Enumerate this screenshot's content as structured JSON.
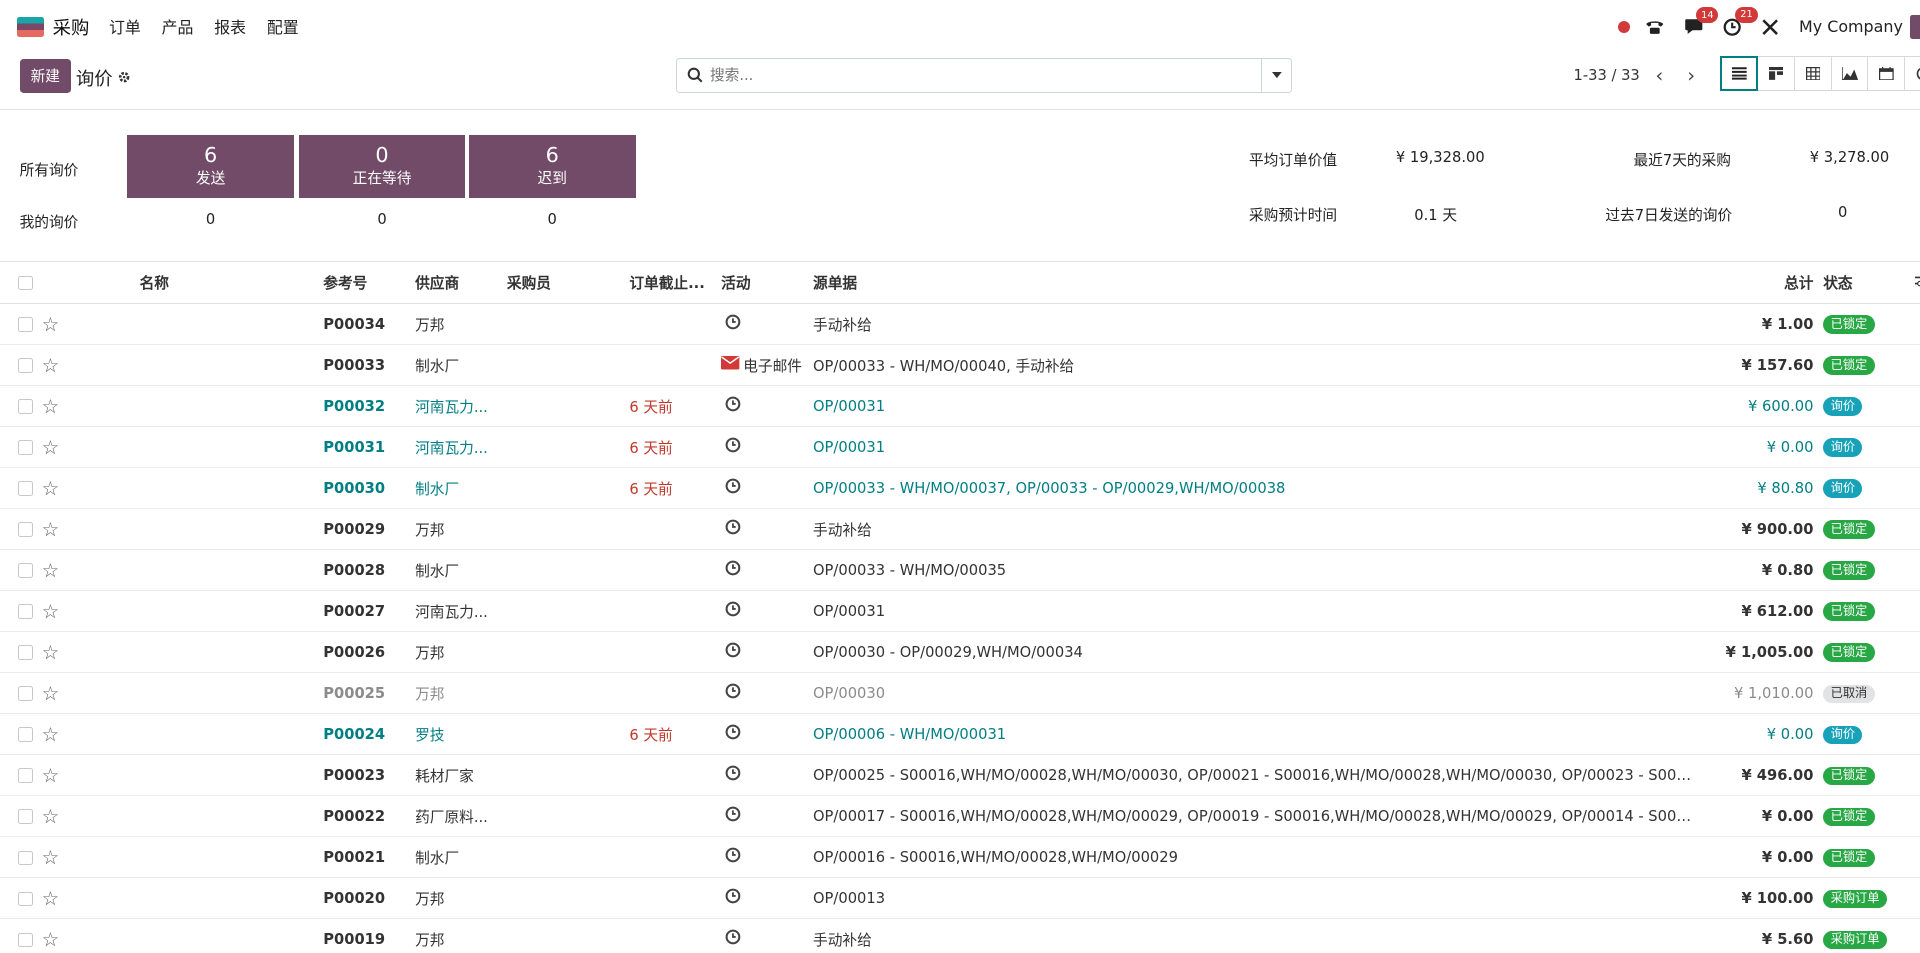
{
  "navbar": {
    "app_name": "采购",
    "menu": [
      "订单",
      "产品",
      "报表",
      "配置"
    ],
    "chat_badge": "14",
    "activity_badge": "21",
    "company": "My Company"
  },
  "cp": {
    "new_label": "新建",
    "breadcrumb": "询价",
    "search_placeholder": "搜索...",
    "pager": "1-33 / 33"
  },
  "dashboard": {
    "all_label": "所有询价",
    "my_label": "我的询价",
    "cards": [
      {
        "value": "6",
        "label": "发送",
        "mine": "0"
      },
      {
        "value": "0",
        "label": "正在等待",
        "mine": "0"
      },
      {
        "value": "6",
        "label": "迟到",
        "mine": "0"
      }
    ],
    "stats": {
      "avg_label": "平均订单价值",
      "avg_value": "¥ 19,328.00",
      "week_label": "最近7天的采购",
      "week_value": "¥ 3,278.00",
      "lead_label": "采购预计时间",
      "lead_value": "0.1 天",
      "sent_label": "过去7日发送的询价",
      "sent_value": "0"
    }
  },
  "table": {
    "headers": {
      "name": "名称",
      "ref": "参考号",
      "vendor": "供应商",
      "buyer": "采购员",
      "deadline": "订单截止...",
      "activity": "活动",
      "source": "源单据",
      "total": "总计",
      "status": "状态"
    },
    "rows": [
      {
        "ref": "P00034",
        "vendor": "万邦",
        "deadline": "",
        "activity": "",
        "source": "手动补给",
        "total": "¥ 1.00",
        "status": "已锁定",
        "style": "normal"
      },
      {
        "ref": "P00033",
        "vendor": "制水厂",
        "deadline": "",
        "activity": "电子邮件",
        "source": "OP/00033 - WH/MO/00040, 手动补给",
        "total": "¥ 157.60",
        "status": "已锁定",
        "style": "normal"
      },
      {
        "ref": "P00032",
        "vendor": "河南瓦力...",
        "deadline": "6 天前",
        "activity": "",
        "source": "OP/00031",
        "total": "¥ 600.00",
        "status": "询价",
        "style": "teal"
      },
      {
        "ref": "P00031",
        "vendor": "河南瓦力...",
        "deadline": "6 天前",
        "activity": "",
        "source": "OP/00031",
        "total": "¥ 0.00",
        "status": "询价",
        "style": "teal"
      },
      {
        "ref": "P00030",
        "vendor": "制水厂",
        "deadline": "6 天前",
        "activity": "",
        "source": "OP/00033 - WH/MO/00037, OP/00033 - OP/00029,WH/MO/00038",
        "total": "¥ 80.80",
        "status": "询价",
        "style": "teal"
      },
      {
        "ref": "P00029",
        "vendor": "万邦",
        "deadline": "",
        "activity": "",
        "source": "手动补给",
        "total": "¥ 900.00",
        "status": "已锁定",
        "style": "normal"
      },
      {
        "ref": "P00028",
        "vendor": "制水厂",
        "deadline": "",
        "activity": "",
        "source": "OP/00033 - WH/MO/00035",
        "total": "¥ 0.80",
        "status": "已锁定",
        "style": "normal"
      },
      {
        "ref": "P00027",
        "vendor": "河南瓦力...",
        "deadline": "",
        "activity": "",
        "source": "OP/00031",
        "total": "¥ 612.00",
        "status": "已锁定",
        "style": "normal"
      },
      {
        "ref": "P00026",
        "vendor": "万邦",
        "deadline": "",
        "activity": "",
        "source": "OP/00030 - OP/00029,WH/MO/00034",
        "total": "¥ 1,005.00",
        "status": "已锁定",
        "style": "normal"
      },
      {
        "ref": "P00025",
        "vendor": "万邦",
        "deadline": "",
        "activity": "",
        "source": "OP/00030",
        "total": "¥ 1,010.00",
        "status": "已取消",
        "style": "muted"
      },
      {
        "ref": "P00024",
        "vendor": "罗技",
        "deadline": "6 天前",
        "activity": "",
        "source": "OP/00006 - WH/MO/00031",
        "total": "¥ 0.00",
        "status": "询价",
        "style": "teal"
      },
      {
        "ref": "P00023",
        "vendor": "耗材厂家",
        "deadline": "",
        "activity": "",
        "source": "OP/00025 - S00016,WH/MO/00028,WH/MO/00030, OP/00021 - S00016,WH/MO/00028,WH/MO/00030, OP/00023 - S00016,WH/MO/00...",
        "total": "¥ 496.00",
        "status": "已锁定",
        "style": "normal"
      },
      {
        "ref": "P00022",
        "vendor": "药厂原料...",
        "deadline": "",
        "activity": "",
        "source": "OP/00017 - S00016,WH/MO/00028,WH/MO/00029, OP/00019 - S00016,WH/MO/00028,WH/MO/00029, OP/00014 - S00016,WH/MO/00...",
        "total": "¥ 0.00",
        "status": "已锁定",
        "style": "normal"
      },
      {
        "ref": "P00021",
        "vendor": "制水厂",
        "deadline": "",
        "activity": "",
        "source": "OP/00016 - S00016,WH/MO/00028,WH/MO/00029",
        "total": "¥ 0.00",
        "status": "已锁定",
        "style": "normal"
      },
      {
        "ref": "P00020",
        "vendor": "万邦",
        "deadline": "",
        "activity": "",
        "source": "OP/00013",
        "total": "¥ 100.00",
        "status": "采购订单",
        "style": "normal"
      },
      {
        "ref": "P00019",
        "vendor": "万邦",
        "deadline": "",
        "activity": "",
        "source": "手动补给",
        "total": "¥ 5.60",
        "status": "采购订单",
        "style": "normal"
      }
    ]
  },
  "status_colors": {
    "已锁定": "#28a745",
    "询价": "#17a2b8",
    "已取消": "#e2e3e5",
    "采购订单": "#28a745"
  },
  "accent": "#714b67"
}
